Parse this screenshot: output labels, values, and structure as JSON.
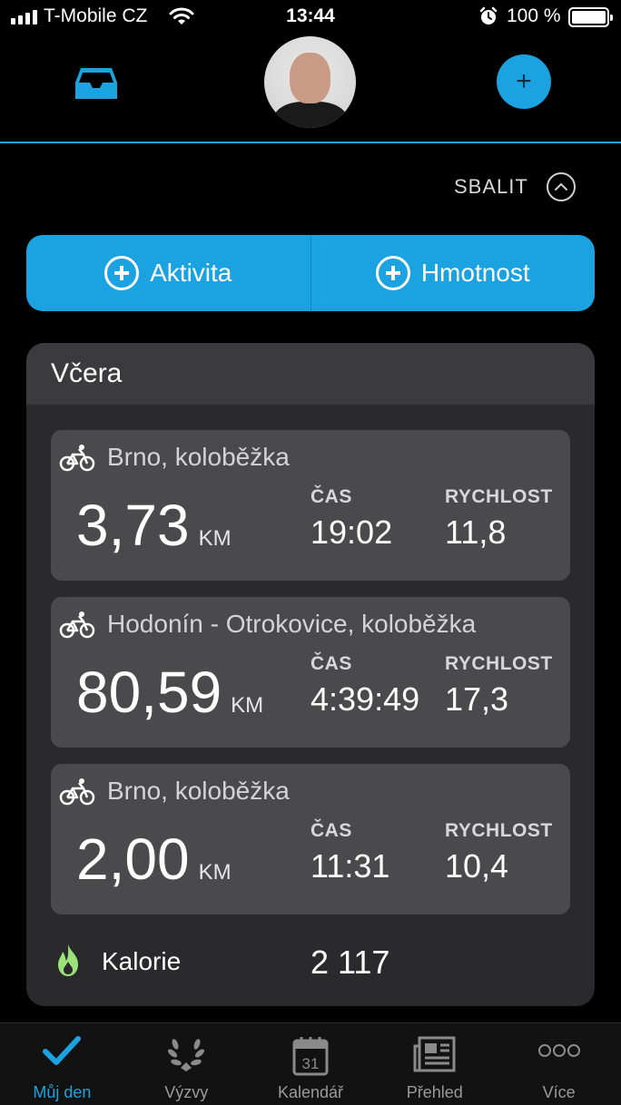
{
  "status_bar": {
    "carrier": "T-Mobile CZ",
    "time": "13:44",
    "battery": "100 %"
  },
  "header": {
    "inbox_icon": "inbox-icon",
    "avatar": "avatar",
    "add_icon": "plus-icon",
    "add_symbol": "+"
  },
  "collapse": {
    "label": "SBALIT",
    "icon": "chevron-up-icon"
  },
  "quick_actions": [
    {
      "label": "Aktivita",
      "icon": "circle-plus-icon"
    },
    {
      "label": "Hmotnost",
      "icon": "circle-plus-icon"
    }
  ],
  "day": {
    "title": "Včera",
    "activities": [
      {
        "title": "Brno, koloběžka",
        "icon": "bike-icon",
        "distance": "3,73",
        "unit": "KM",
        "time_label": "ČAS",
        "time": "19:02",
        "speed_label": "RYCHLOST",
        "speed": "11,8"
      },
      {
        "title": "Hodonín - Otrokovice, koloběžka",
        "icon": "bike-icon",
        "distance": "80,59",
        "unit": "KM",
        "time_label": "ČAS",
        "time": "4:39:49",
        "speed_label": "RYCHLOST",
        "speed": "17,3"
      },
      {
        "title": "Brno, koloběžka",
        "icon": "bike-icon",
        "distance": "2,00",
        "unit": "KM",
        "time_label": "ČAS",
        "time": "11:31",
        "speed_label": "RYCHLOST",
        "speed": "10,4"
      }
    ],
    "calories": {
      "label": "Kalorie",
      "value": "2 117",
      "icon": "flame-icon"
    }
  },
  "tabbar": [
    {
      "label": "Můj den",
      "icon": "checkmark-icon",
      "active": true
    },
    {
      "label": "Výzvy",
      "icon": "laurel-icon",
      "active": false
    },
    {
      "label": "Kalendář",
      "icon": "calendar-icon",
      "icon_text": "31",
      "active": false
    },
    {
      "label": "Přehled",
      "icon": "newspaper-icon",
      "active": false
    },
    {
      "label": "Více",
      "icon": "more-icon",
      "active": false
    }
  ],
  "colors": {
    "accent": "#1aa3e0",
    "background": "#000000",
    "card": "#2a2a2c",
    "activity_card": "#4a4a4c",
    "flame": "#9be27a"
  }
}
